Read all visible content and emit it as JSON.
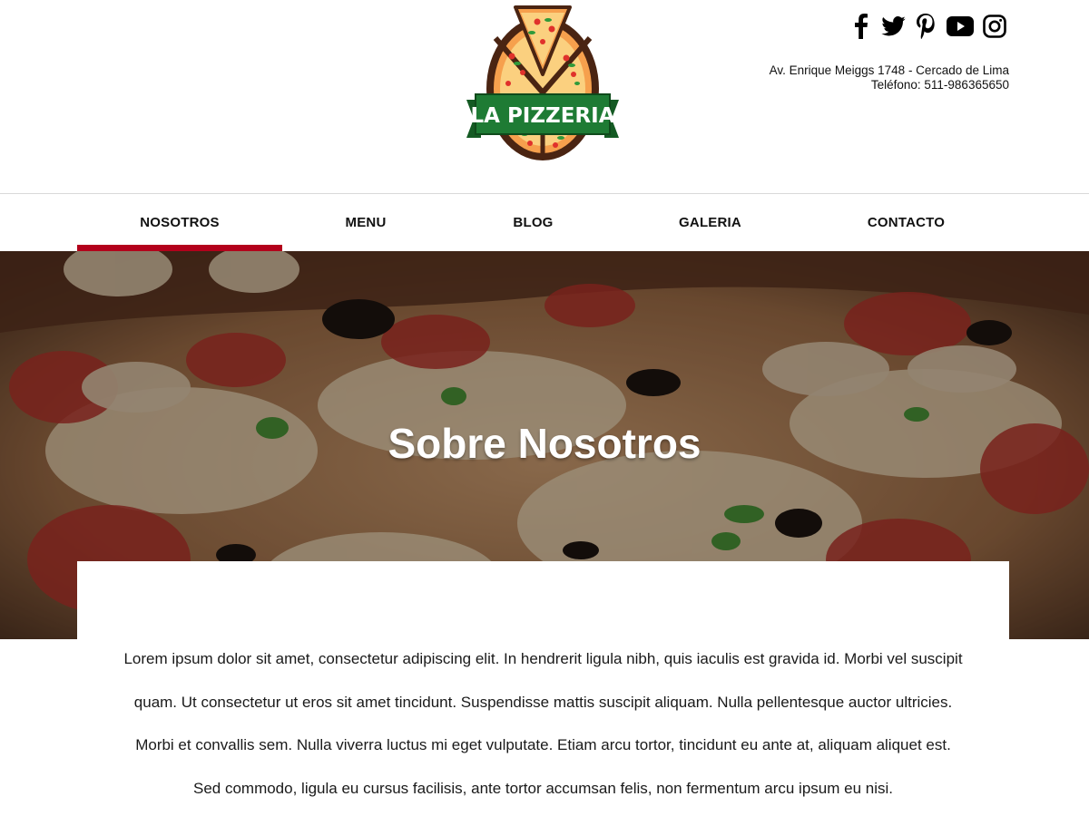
{
  "brand": {
    "logo_text": "LA PIZZERIA",
    "colors": {
      "accent_red": "#b3001b",
      "logo_green": "#1e7b34",
      "logo_orange": "#f6a04d",
      "logo_brown": "#4a2412"
    }
  },
  "social": [
    {
      "name": "facebook-icon"
    },
    {
      "name": "twitter-icon"
    },
    {
      "name": "pinterest-icon"
    },
    {
      "name": "youtube-icon"
    },
    {
      "name": "instagram-icon"
    }
  ],
  "contact": {
    "address": "Av. Enrique Meiggs 1748 - Cercado de Lima",
    "phone": "Teléfono: 511-986365650"
  },
  "nav": {
    "items": [
      {
        "label": "NOSOTROS",
        "active": true
      },
      {
        "label": "MENU",
        "active": false
      },
      {
        "label": "BLOG",
        "active": false
      },
      {
        "label": "GALERIA",
        "active": false
      },
      {
        "label": "CONTACTO",
        "active": false
      }
    ]
  },
  "hero": {
    "title": "Sobre Nosotros"
  },
  "content": {
    "paragraph": "Lorem ipsum dolor sit amet, consectetur adipiscing elit. In hendrerit ligula nibh, quis iaculis est gravida id. Morbi vel suscipit quam. Ut consectetur ut eros sit amet tincidunt. Suspendisse mattis suscipit aliquam. Nulla pellentesque auctor ultricies. Morbi et convallis sem. Nulla viverra luctus mi eget vulputate. Etiam arcu tortor, tincidunt eu ante at, aliquam aliquet est. Sed commodo, ligula eu cursus facilisis, ante tortor accumsan felis, non fermentum arcu ipsum eu nisi."
  }
}
